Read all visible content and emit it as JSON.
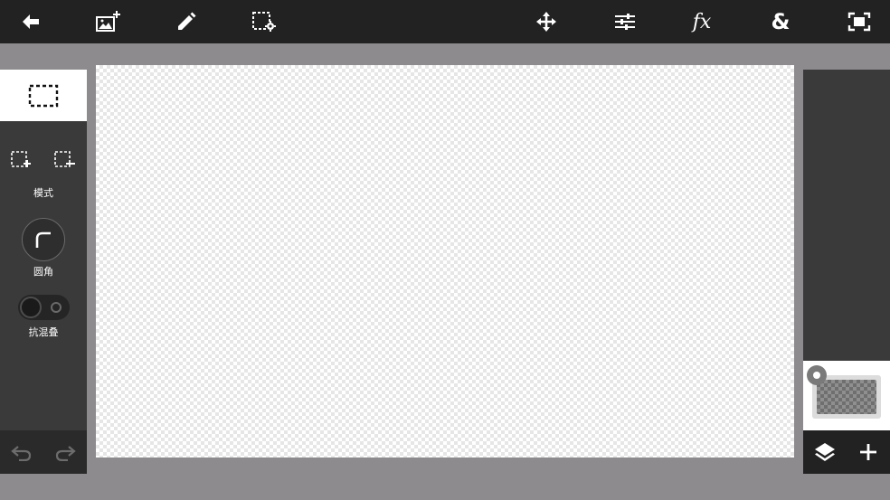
{
  "toolbar": {
    "buttons": [
      {
        "name": "back",
        "icon": "arrow-left-icon"
      },
      {
        "name": "add-image",
        "icon": "add-image-icon"
      },
      {
        "name": "draw",
        "icon": "pencil-icon"
      },
      {
        "name": "selection-settings",
        "icon": "selection-settings-icon"
      },
      {
        "name": "move",
        "icon": "move-icon"
      },
      {
        "name": "adjust",
        "icon": "sliders-icon"
      },
      {
        "name": "effects",
        "icon": "fx-icon",
        "glyph": "fx"
      },
      {
        "name": "blend",
        "icon": "ampersand-icon",
        "glyph": "&"
      },
      {
        "name": "fit-screen",
        "icon": "fit-screen-icon"
      }
    ]
  },
  "left_panel": {
    "select_tool_icon": "rect-select-icon",
    "mode_add_icon": "select-add-icon",
    "mode_subtract_icon": "select-subtract-icon",
    "mode_label": "模式",
    "corner_label": "圆角",
    "antialias_label": "抗混叠",
    "antialias_on": false,
    "undo_icon": "undo-icon",
    "redo_icon": "redo-icon"
  },
  "right_panel": {
    "layers_icon": "layers-icon",
    "add_layer_icon": "plus-icon"
  },
  "colors": {
    "toolbar_bg": "#222222",
    "panel_bg": "#3a3a3a",
    "workspace_bg": "#8d8b8d",
    "icon": "#ffffff"
  }
}
